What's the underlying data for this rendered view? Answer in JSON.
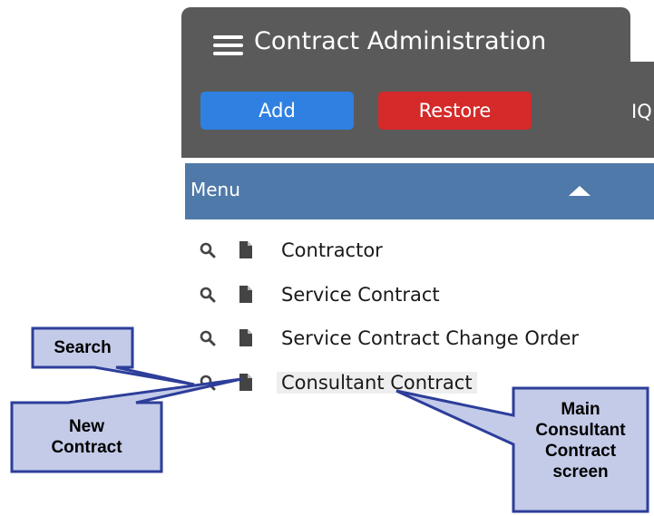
{
  "app": {
    "title": "Contract Administration",
    "toolbar": {
      "add_label": "Add",
      "restore_label": "Restore",
      "truncated_label": "IQ"
    },
    "menu": {
      "title": "Menu",
      "items": [
        {
          "label": "Contractor"
        },
        {
          "label": "Service Contract"
        },
        {
          "label": "Service Contract Change Order"
        },
        {
          "label": "Consultant Contract"
        }
      ]
    }
  },
  "callouts": {
    "search": "Search",
    "new_contract_line1": "New",
    "new_contract_line2": "Contract",
    "main_line1": "Main",
    "main_line2": "Consultant",
    "main_line3": "Contract",
    "main_line4": "screen"
  },
  "colors": {
    "header_gray": "#5a5a5a",
    "add_blue": "#2f80e0",
    "restore_red": "#d42a2a",
    "menu_blue": "#4f79a8",
    "callout_fill": "#c4cbe8",
    "callout_border": "#2d3e9a"
  }
}
